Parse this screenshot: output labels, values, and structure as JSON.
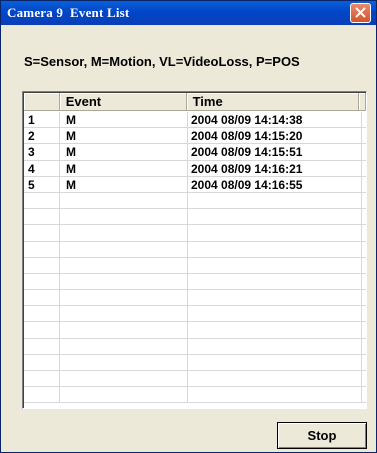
{
  "window": {
    "title": "Camera 9  Event List"
  },
  "legend": "S=Sensor, M=Motion, VL=VideoLoss, P=POS",
  "table": {
    "columns": [
      "",
      "Event",
      "Time"
    ],
    "rows": [
      {
        "num": "1",
        "event": "M",
        "time": "2004 08/09 14:14:38"
      },
      {
        "num": "2",
        "event": "M",
        "time": "2004 08/09 14:15:20"
      },
      {
        "num": "3",
        "event": "M",
        "time": "2004 08/09 14:15:51"
      },
      {
        "num": "4",
        "event": "M",
        "time": "2004 08/09 14:16:21"
      },
      {
        "num": "5",
        "event": "M",
        "time": "2004 08/09 14:16:55"
      }
    ]
  },
  "buttons": {
    "stop_label": "Stop"
  },
  "colors": {
    "titlebar": "#0a3fb8",
    "close_button": "#d2532f",
    "dialog_background": "#ece9d8"
  }
}
